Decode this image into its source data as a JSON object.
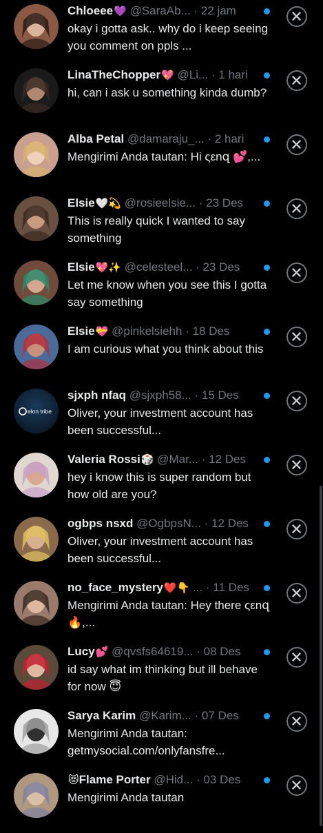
{
  "conversations": [
    {
      "name": "Chloeee",
      "emoji": "💜",
      "handle": "@SaraAb...",
      "time": "· 22 jam",
      "message": "okay i gotta ask.. why do i keep seeing you comment on ppls ...",
      "avatar": "chloeee"
    },
    {
      "name": "LinaTheChopper",
      "emoji": "💖",
      "handle": "@Li...",
      "time": "· 1 hari",
      "message": "hi, can i ask u something kinda dumb?",
      "avatar": "lina"
    },
    {
      "name": "Alba Petal",
      "emoji": "",
      "handle": "@damaraju_...",
      "time": "· 2 hari",
      "message": "Mengirimi Anda tautan: Hi ςεnզ 💕,...",
      "avatar": "alba"
    },
    {
      "name": "Elsie",
      "emoji": "🤍💫",
      "handle": "@rosieelsie...",
      "time": "· 23 Des",
      "message": "This is really quick I wanted to say something",
      "avatar": "elsie1"
    },
    {
      "name": "Elsie",
      "emoji": "💖✨",
      "handle": "@celesteel...",
      "time": "· 23 Des",
      "message": "Let me know when you see this I gotta say something",
      "avatar": "elsie2"
    },
    {
      "name": "Elsie",
      "emoji": "💝",
      "handle": "@pinkelsiehh",
      "time": "· 18 Des",
      "message": "I am curious what you think about this",
      "avatar": "elsie3"
    },
    {
      "name": "sjxph nfaq",
      "emoji": "",
      "handle": "@sjxph58...",
      "time": "· 15 Des",
      "message": "Oliver, your investment account has been successful...",
      "avatar": "elon",
      "avatar_text": "elon tribe"
    },
    {
      "name": "Valeria Rossi",
      "emoji": "🎲",
      "handle": "@Mar...",
      "time": "· 12 Des",
      "message": "hey i know this is super random but how old are you?",
      "avatar": "valeria"
    },
    {
      "name": "ogbps nsxd",
      "emoji": "",
      "handle": "@OgbpsN...",
      "time": "· 12 Des",
      "message": "Oliver, your investment account has been successful...",
      "avatar": "ogbps"
    },
    {
      "name": "no_face_mystery",
      "emoji": "❤️👇",
      "handle": "...",
      "time": "· 11 Des",
      "message": "Mengirimi Anda tautan: Hey there ςεnզ 🔥,...",
      "avatar": "noface"
    },
    {
      "name": "Lucy",
      "emoji": "💕",
      "handle": "@qvsfs64619...",
      "time": "· 08 Des",
      "message": "id say what im thinking but ill behave for now 😇",
      "avatar": "lucy"
    },
    {
      "name": "Sarya Karim",
      "emoji": "",
      "handle": "@Karim...",
      "time": "· 07 Des",
      "message": "Mengirimi Anda tautan: getmysocial.com/onlyfansfre...",
      "avatar": "sarya"
    },
    {
      "name": "Flame Porter",
      "emoji": "😻",
      "handle": "@Hid...",
      "time": "· 03 Des",
      "message": "Mengirimi Anda tautan",
      "avatar": "flame",
      "emoji_first": true
    }
  ],
  "colors": {
    "background": "#000000",
    "text": "#e7e9ea",
    "muted": "#71767b",
    "unread_dot": "#1d9bf0"
  },
  "icons": {
    "dismiss": "close-circle-icon",
    "unread": "unread-dot-icon"
  }
}
